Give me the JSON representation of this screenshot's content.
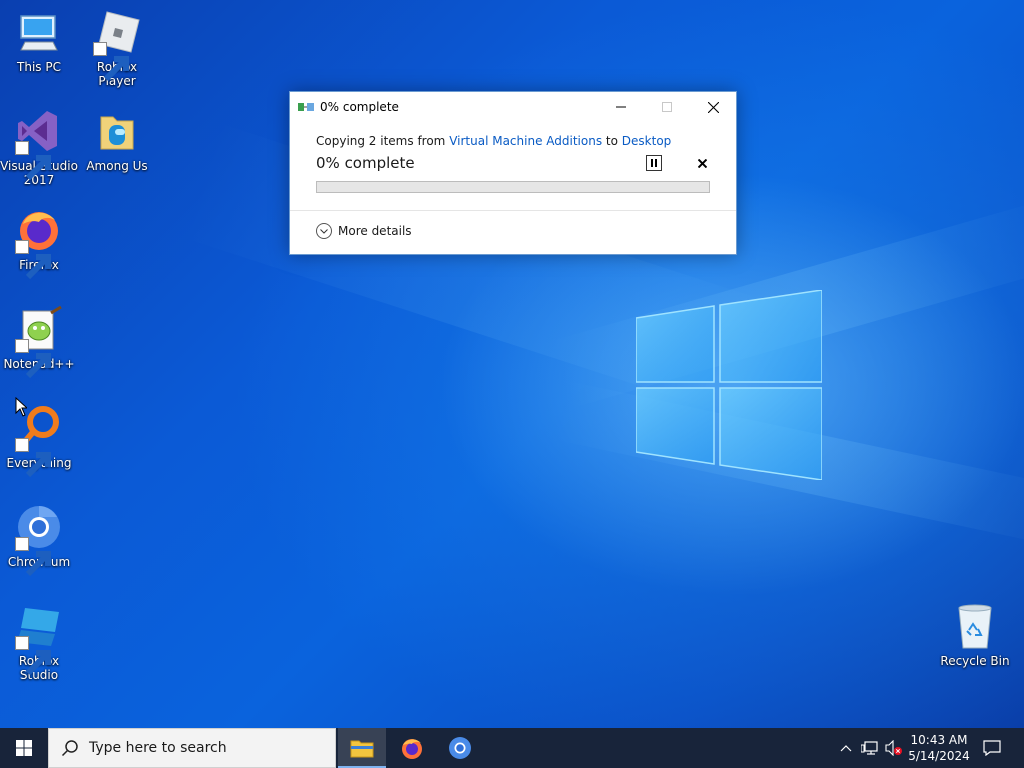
{
  "desktop": {
    "icons": [
      {
        "label": "This PC",
        "icon": "this-pc-icon"
      },
      {
        "label": "Roblox Player",
        "icon": "roblox-player-icon"
      },
      {
        "label": "Visual Studio 2017",
        "icon": "visual-studio-icon"
      },
      {
        "label": "Among Us",
        "icon": "among-us-icon"
      },
      {
        "label": "Firefox",
        "icon": "firefox-icon"
      },
      {
        "label": "Notepad++",
        "icon": "notepadpp-icon"
      },
      {
        "label": "Everything",
        "icon": "everything-icon"
      },
      {
        "label": "Chromium",
        "icon": "chromium-icon"
      },
      {
        "label": "Roblox Studio",
        "icon": "roblox-studio-icon"
      },
      {
        "label": "Recycle Bin",
        "icon": "recycle-bin-icon"
      }
    ]
  },
  "dialog": {
    "title": "0% complete",
    "copy_prefix": "Copying 2 items from",
    "source": "Virtual Machine Additions",
    "to_word": "to",
    "destination": "Desktop",
    "percent_text": "0% complete",
    "progress_fraction": 0,
    "more_details": "More details",
    "accent_link": "#0a5bc4"
  },
  "taskbar": {
    "search_placeholder": "Type here to search",
    "pinned": [
      "File Explorer",
      "Firefox",
      "Chromium"
    ],
    "clock_time": "10:43 AM",
    "clock_date": "5/14/2024"
  }
}
